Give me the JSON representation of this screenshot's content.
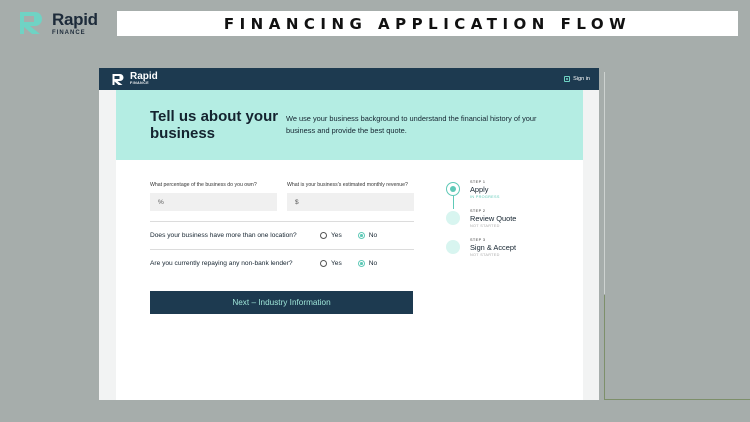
{
  "banner": {
    "brand_name": "Rapid",
    "brand_sub": "FINANCE",
    "title": "FINANCING APPLICATION FLOW"
  },
  "app": {
    "nav": {
      "logo_name": "Rapid",
      "logo_sub": "FINANCE",
      "signin_label": "Sign in"
    },
    "hero": {
      "title": "Tell us about your business",
      "description": "We use your business background to understand the financial history of your business and provide the best quote."
    },
    "form": {
      "ownership_label": "What percentage of the business do you own?",
      "ownership_placeholder": "%",
      "revenue_label": "What is your business's estimated monthly revenue?",
      "revenue_placeholder": "$",
      "questions": [
        {
          "text": "Does your business have more than one location?",
          "yes": "Yes",
          "no": "No",
          "selected": "No"
        },
        {
          "text": "Are you currently repaying any non-bank lender?",
          "yes": "Yes",
          "no": "No",
          "selected": "No"
        }
      ],
      "next_button": "Next – Industry Information"
    },
    "steps": [
      {
        "num": "STEP 1",
        "name": "Apply",
        "status": "IN PROGRESS",
        "active": true
      },
      {
        "num": "STEP 2",
        "name": "Review Quote",
        "status": "NOT STARTED",
        "active": false
      },
      {
        "num": "STEP 3",
        "name": "Sign & Accept",
        "status": "NOT STARTED",
        "active": false
      }
    ]
  },
  "colors": {
    "navy": "#1d3a50",
    "mint": "#b4ede3",
    "accent": "#5fc9b7",
    "backdrop": "#a6adab"
  }
}
